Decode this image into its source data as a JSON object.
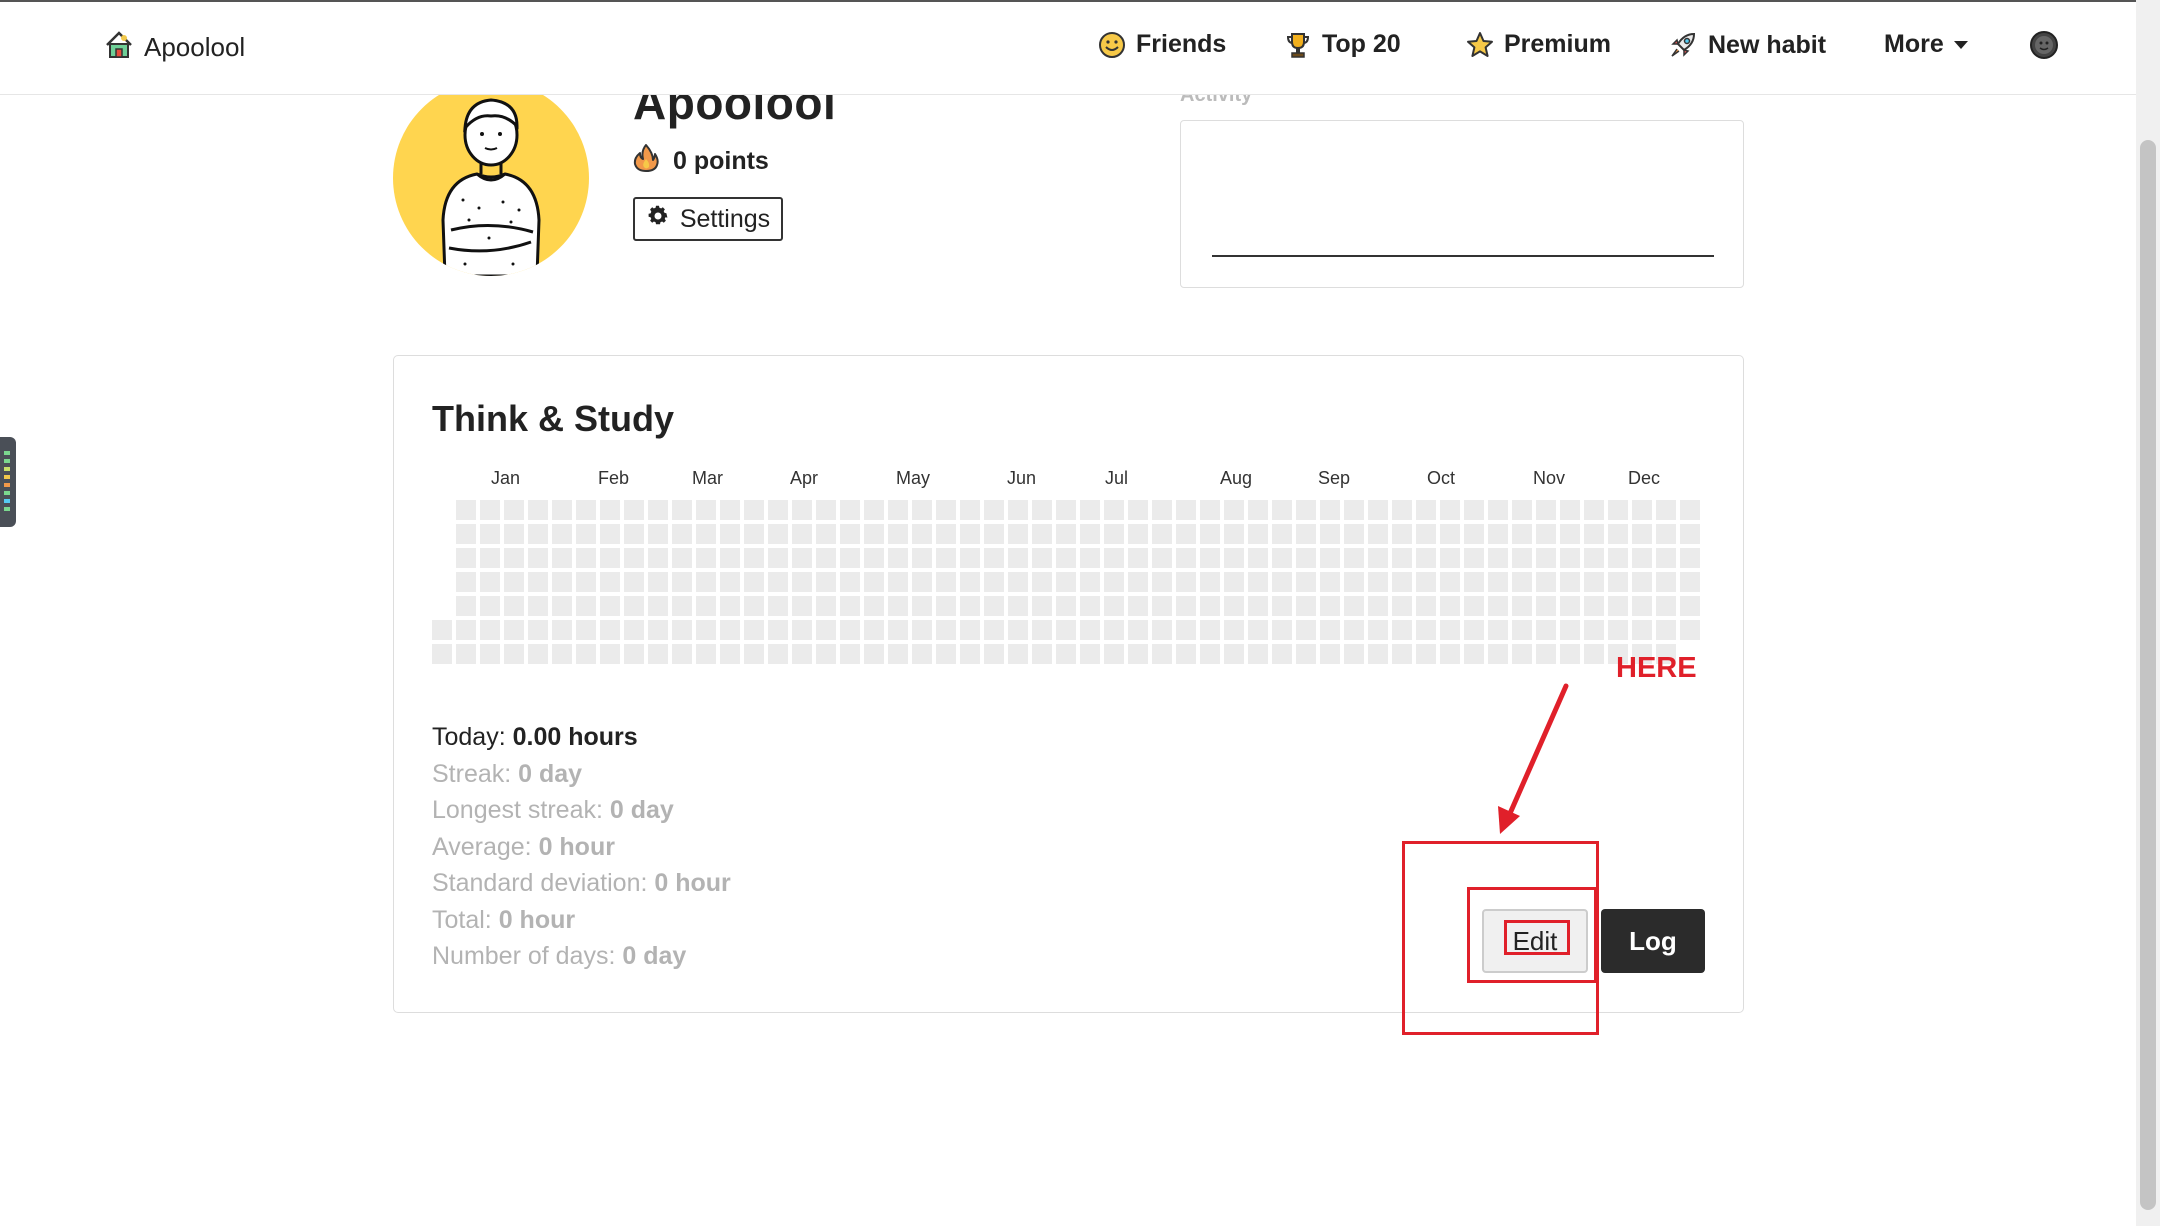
{
  "nav": {
    "brand": "Apoolool",
    "items": [
      {
        "label": "Friends",
        "icon": "smiley-icon"
      },
      {
        "label": "Top 20",
        "icon": "trophy-icon"
      },
      {
        "label": "Premium",
        "icon": "star-icon"
      },
      {
        "label": "New habit",
        "icon": "rocket-icon"
      },
      {
        "label": "More",
        "icon": "caret-down-icon"
      }
    ],
    "user_icon": "user-avatar-icon"
  },
  "profile": {
    "username": "Apoolool",
    "points": "0 points",
    "settings_label": "Settings",
    "activity_label": "Activity"
  },
  "habit": {
    "title": "Think & Study",
    "months": [
      "Jan",
      "Feb",
      "Mar",
      "Apr",
      "May",
      "Jun",
      "Jul",
      "Aug",
      "Sep",
      "Oct",
      "Nov",
      "Dec"
    ],
    "stats": [
      {
        "label": "Today: ",
        "value": "0.00 hours"
      },
      {
        "label": "Streak: ",
        "value": "0 day"
      },
      {
        "label": "Longest streak: ",
        "value": "0 day"
      },
      {
        "label": "Average: ",
        "value": "0 hour"
      },
      {
        "label": "Standard deviation: ",
        "value": "0 hour"
      },
      {
        "label": "Total: ",
        "value": "0 hour"
      },
      {
        "label": "Number of days: ",
        "value": "0 day"
      }
    ],
    "edit_label": "Edit",
    "log_label": "Log"
  },
  "annotation": {
    "text": "HERE",
    "color": "#e0202a"
  },
  "colors": {
    "avatar_bg": "#ffd54f",
    "heatmap_empty": "#ebebeb",
    "log_button_bg": "#2b2b2b"
  }
}
